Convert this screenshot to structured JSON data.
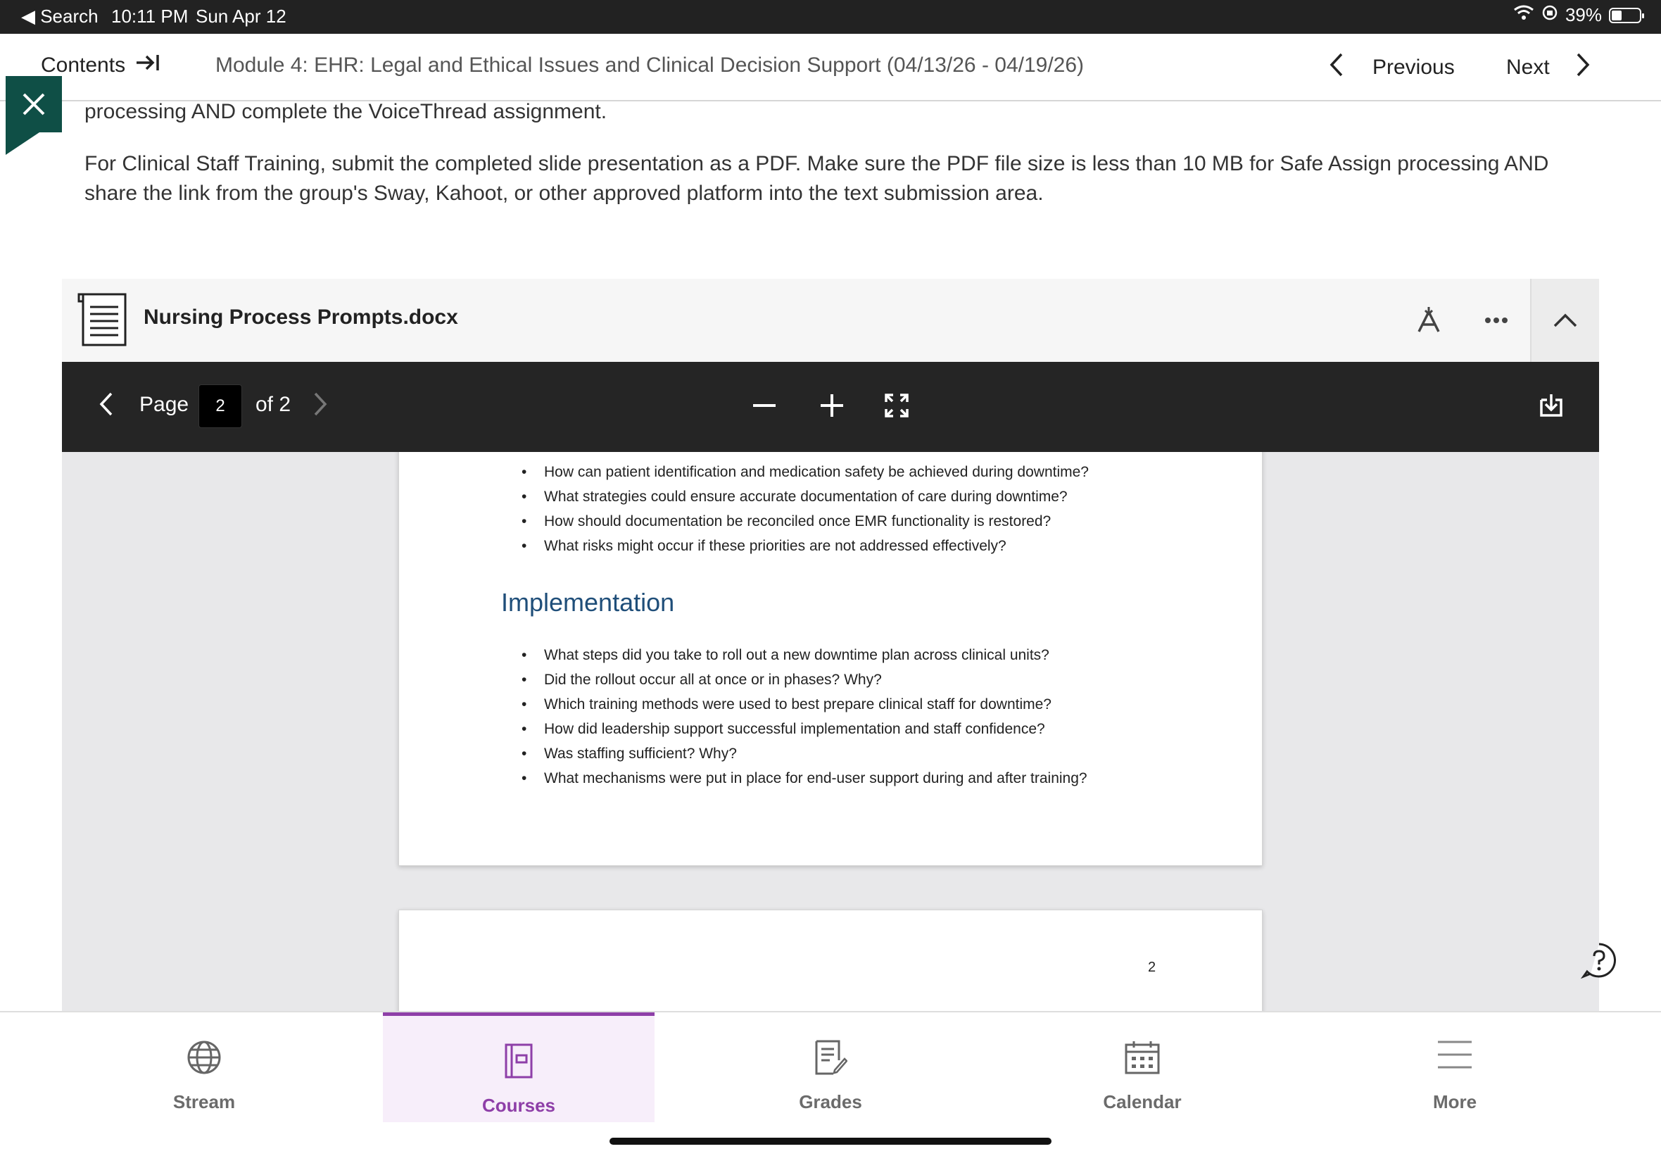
{
  "status_bar": {
    "back_label": "◀ Search",
    "time": "10:11 PM",
    "date": "Sun Apr 12",
    "battery": "39%"
  },
  "nav": {
    "contents_label": "Contents",
    "module_title": "Module 4: EHR: Legal and Ethical Issues and Clinical Decision Support (04/13/26 - 04/19/26)",
    "previous_label": "Previous",
    "next_label": "Next"
  },
  "instructions": {
    "line1": "processing AND complete the VoiceThread assignment.",
    "paragraph2": "For Clinical Staff Training, submit the completed slide presentation as a PDF. Make sure the PDF file size is less than 10 MB for Safe Assign processing AND share the link from the group's Sway, Kahoot, or other approved platform into the text submission area."
  },
  "document": {
    "filename": "Nursing Process Prompts.docx",
    "page_label": "Page",
    "current_page": "2",
    "of_pages": "of 2",
    "bullets_top": [
      "How can patient identification and medication safety be achieved during downtime?",
      "What strategies could ensure accurate documentation of care during downtime?",
      "How should documentation be reconciled once EMR functionality is restored?",
      "What risks might occur if these priorities are not addressed effectively?"
    ],
    "section_heading": "Implementation",
    "bullets_implementation": [
      "What steps did you take to roll out a new downtime plan across clinical units?",
      "Did the rollout occur all at once or in phases? Why?",
      "Which training methods were used to best prepare clinical staff for downtime?",
      "How did leadership support successful implementation and staff confidence?",
      "Was staffing sufficient? Why?",
      "What mechanisms were put in place for end-user support during and after training?"
    ],
    "footer_page_number": "2"
  },
  "tabs": [
    {
      "label": "Stream",
      "icon": "globe-icon"
    },
    {
      "label": "Courses",
      "icon": "courses-icon",
      "active": true
    },
    {
      "label": "Grades",
      "icon": "grades-icon"
    },
    {
      "label": "Calendar",
      "icon": "calendar-icon"
    },
    {
      "label": "More",
      "icon": "menu-icon"
    }
  ],
  "colors": {
    "accent": "#8e3fa8",
    "close_flag": "#0f4f46",
    "viewer_bar": "#252525",
    "heading": "#1f4e79"
  }
}
